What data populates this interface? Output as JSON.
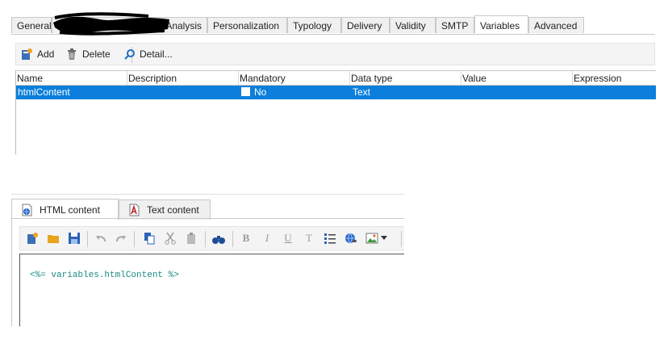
{
  "tabs": {
    "general": "General",
    "analysis": "Analysis",
    "personalization": "Personalization",
    "typology": "Typology",
    "delivery": "Delivery",
    "validity": "Validity",
    "smtp": "SMTP",
    "variables": "Variables",
    "advanced": "Advanced",
    "active": "Variables"
  },
  "toolbar": {
    "add_label": "Add",
    "delete_label": "Delete",
    "detail_label": "Detail..."
  },
  "grid": {
    "columns": [
      "Name",
      "Description",
      "Mandatory",
      "Data type",
      "Value",
      "Expression"
    ],
    "rows": [
      {
        "name": "htmlContent",
        "description": "",
        "mandatory": "No",
        "data_type": "Text",
        "value": "",
        "expression": "",
        "selected": true
      }
    ]
  },
  "editor": {
    "tabs": [
      "HTML content",
      "Text content"
    ],
    "active_tab": "HTML content",
    "content": "<%= variables.htmlContent %>",
    "format_letters": {
      "bold": "B",
      "italic": "I",
      "underline": "U",
      "clear": "T"
    }
  },
  "colors": {
    "selection": "#0b7fdb",
    "code_text": "#1a8a88"
  }
}
